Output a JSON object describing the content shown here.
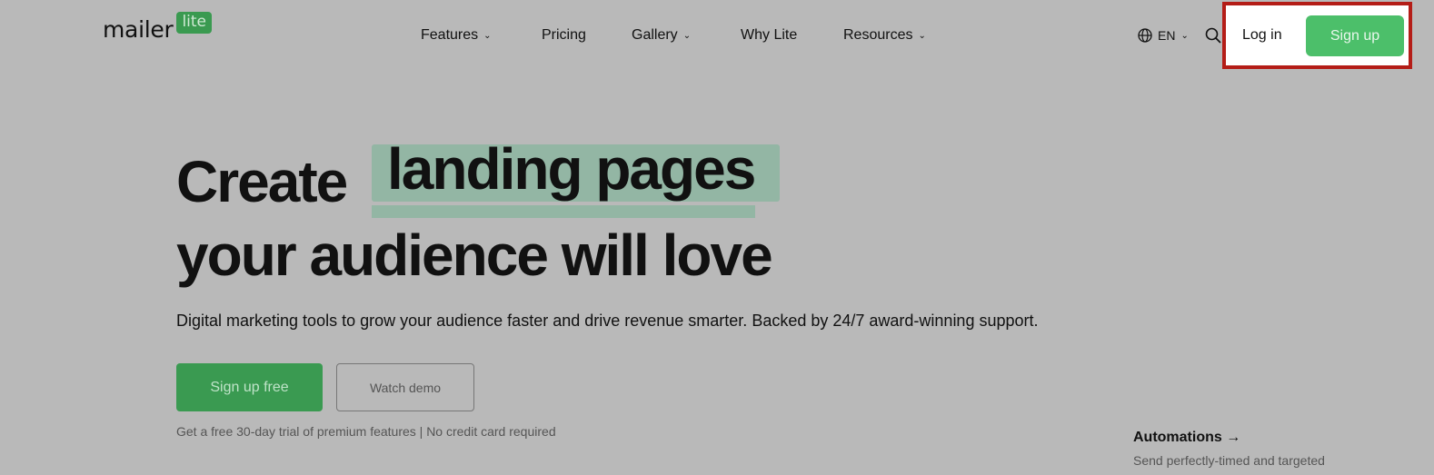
{
  "brand": {
    "word": "mailer",
    "badge": "lite",
    "color": "#3a9a50"
  },
  "nav": [
    {
      "label": "Features",
      "dropdown": true
    },
    {
      "label": "Pricing",
      "dropdown": false
    },
    {
      "label": "Gallery",
      "dropdown": true
    },
    {
      "label": "Why Lite",
      "dropdown": false
    },
    {
      "label": "Resources",
      "dropdown": true
    }
  ],
  "header": {
    "language": "EN",
    "globe_icon": "globe-icon",
    "search_icon": "search-icon",
    "login": "Log in",
    "signup": "Sign up",
    "signup_color": "#4cbf6a"
  },
  "hero": {
    "title_start": "Create",
    "title_highlight": "landing pages",
    "title_end": "your audience will love",
    "subtitle": "Digital marketing tools to grow your audience faster and drive revenue smarter. Backed by 24/7 award-winning support.",
    "primary_cta": "Sign up free",
    "secondary_cta": "Watch demo",
    "note": "Get a free 30-day trial of premium features | No credit card required"
  },
  "feature": {
    "title": "Automations →",
    "description": "Send perfectly-timed and targeted"
  }
}
